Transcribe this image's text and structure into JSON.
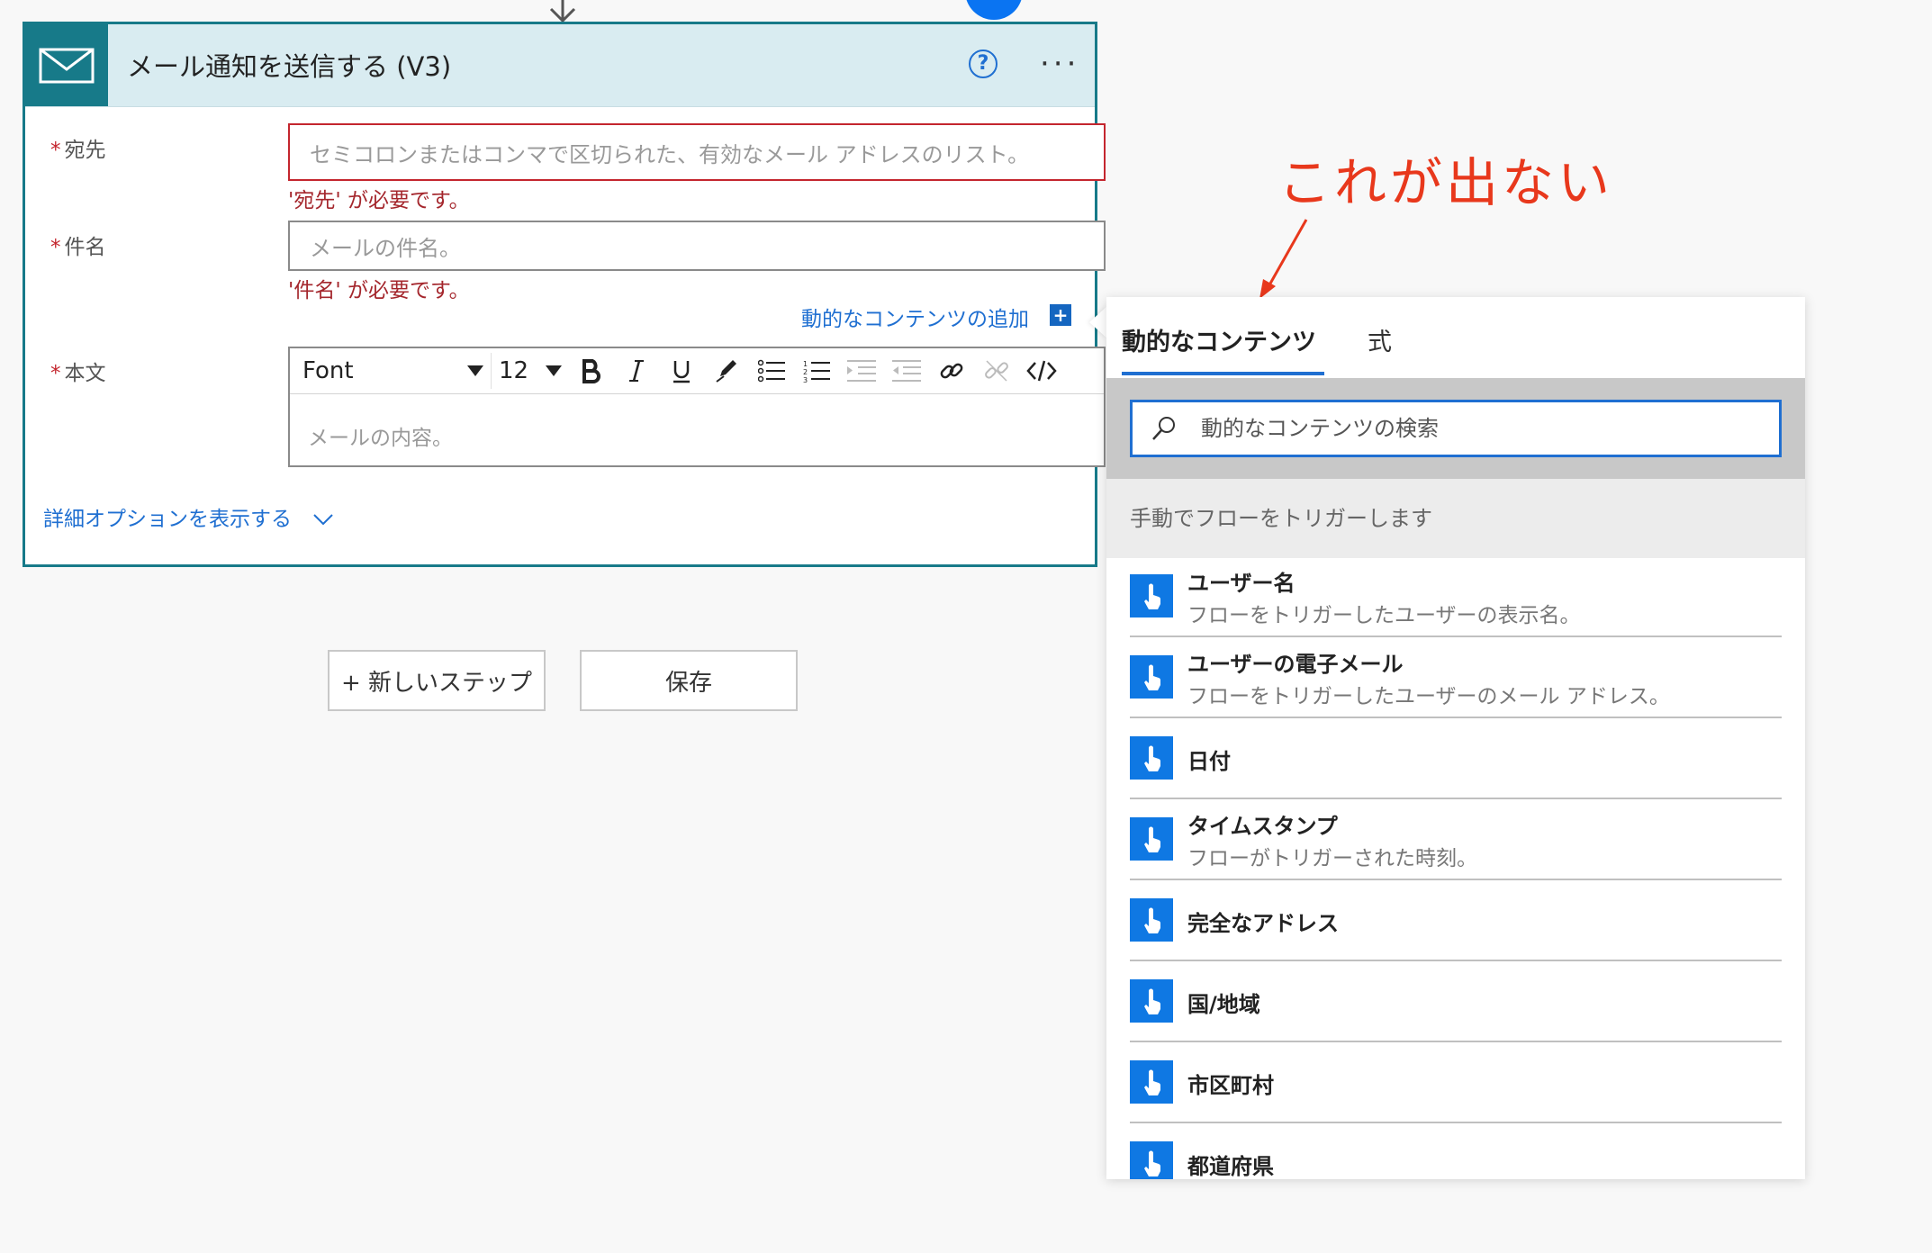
{
  "card": {
    "title": "メール通知を送信する (V3)",
    "help_glyph": "?",
    "more_glyph": "···",
    "fields": {
      "to": {
        "label": "宛先",
        "placeholder": "セミコロンまたはコンマで区切られた、有効なメール アドレスのリスト。",
        "error": "'宛先' が必要です。"
      },
      "subject": {
        "label": "件名",
        "placeholder": "メールの件名。",
        "error": "'件名' が必要です。"
      },
      "body": {
        "label": "本文",
        "placeholder": "メールの内容。"
      }
    },
    "required_mark": "*",
    "add_dynamic_label": "動的なコンテンツの追加",
    "add_dynamic_plus": "+",
    "advanced_label": "詳細オプションを表示する",
    "toolbar": {
      "font": "Font",
      "size": "12"
    }
  },
  "steps": {
    "new_step": "+ 新しいステップ",
    "save": "保存"
  },
  "annotation": "これが出ない",
  "panel": {
    "tabs": [
      {
        "label": "動的なコンテンツ",
        "active": true
      },
      {
        "label": "式",
        "active": false
      }
    ],
    "search_placeholder": "動的なコンテンツの検索",
    "group_header": "手動でフローをトリガーします",
    "items": [
      {
        "title": "ユーザー名",
        "desc": "フローをトリガーしたユーザーの表示名。"
      },
      {
        "title": "ユーザーの電子メール",
        "desc": "フローをトリガーしたユーザーのメール アドレス。"
      },
      {
        "title": "日付",
        "desc": ""
      },
      {
        "title": "タイムスタンプ",
        "desc": "フローがトリガーされた時刻。"
      },
      {
        "title": "完全なアドレス",
        "desc": ""
      },
      {
        "title": "国/地域",
        "desc": ""
      },
      {
        "title": "市区町村",
        "desc": ""
      },
      {
        "title": "都道府県",
        "desc": ""
      }
    ]
  },
  "colors": {
    "accent": "#177a89",
    "link": "#1f6fd1",
    "error": "#a4262c",
    "annotation": "#e8381c",
    "item_icon": "#0f78e3"
  }
}
